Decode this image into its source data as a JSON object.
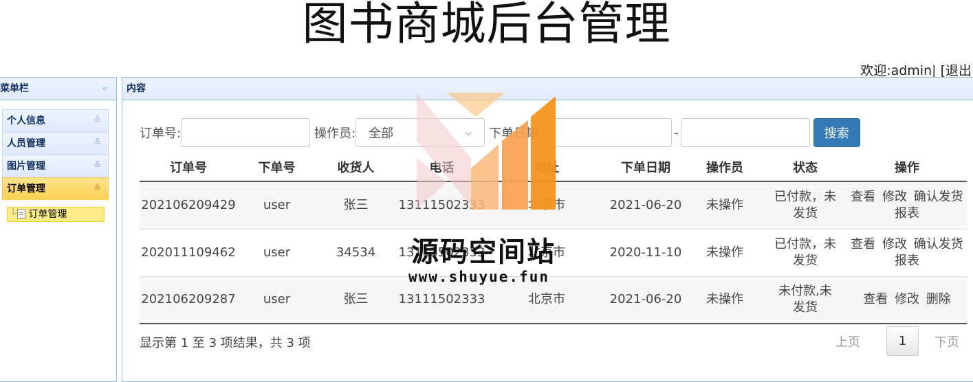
{
  "title": "图书商城后台管理",
  "userbar": {
    "welcome": "欢迎:",
    "username": "admin|",
    "logout": "[退出"
  },
  "sidebar": {
    "header": "菜单栏",
    "items": [
      {
        "label": "个人信息",
        "active": false
      },
      {
        "label": "人员管理",
        "active": false
      },
      {
        "label": "图片管理",
        "active": false
      },
      {
        "label": "订单管理",
        "active": true
      }
    ],
    "sub_item": "订单管理"
  },
  "content": {
    "header": "内容",
    "search": {
      "order_label": "订单号:",
      "order_value": "",
      "operator_label": "操作员:",
      "operator_selected": "全部",
      "date_label": "下单日期:",
      "date_from": "",
      "date_sep": "-",
      "date_to": "",
      "search_button": "搜索"
    },
    "table": {
      "headers": [
        "订单号",
        "下单号",
        "收货人",
        "电话",
        "地址",
        "下单日期",
        "操作员",
        "状态",
        "操作"
      ],
      "rows": [
        {
          "order_no": "202106209429",
          "user": "user",
          "receiver": "张三",
          "phone": "13111502333",
          "address": "北京市",
          "date": "2021-06-20",
          "operator": "未操作",
          "status": "已付款，未发货",
          "ops": [
            "查看",
            "修改",
            "确认发货",
            "报表"
          ]
        },
        {
          "order_no": "202011109462",
          "user": "user",
          "receiver": "34534",
          "phone": "13111502333",
          "address": "北京市",
          "date": "2020-11-10",
          "operator": "未操作",
          "status": "已付款，未发货",
          "ops": [
            "查看",
            "修改",
            "确认发货",
            "报表"
          ]
        },
        {
          "order_no": "202106209287",
          "user": "user",
          "receiver": "张三",
          "phone": "13111502333",
          "address": "北京市",
          "date": "2021-06-20",
          "operator": "未操作",
          "status": "未付款,未发货",
          "ops": [
            "查看",
            "修改",
            "删除"
          ]
        }
      ]
    },
    "info": "显示第 1 至 3 项结果，共 3 项",
    "pager": {
      "prev": "上页",
      "current": "1",
      "next": "下页"
    }
  },
  "watermark": {
    "text": "源码空间站",
    "url": "www.shuyue.fun"
  },
  "colors": {
    "accent": "#337ab7",
    "panel_border": "#95b8e7",
    "active_item": "#ffd050",
    "watermark_orange": "#f7941d"
  }
}
